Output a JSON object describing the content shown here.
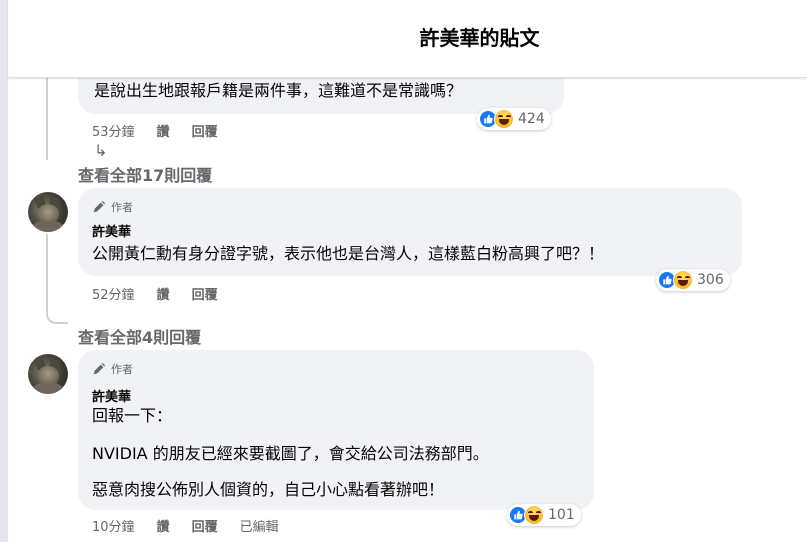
{
  "header": {
    "title": "許美華的貼文"
  },
  "comments": [
    {
      "text": "是說出生地跟報戶籍是兩件事，這難道不是常識嗎？",
      "time": "53分鐘",
      "like_label": "讚",
      "reply_label": "回覆",
      "reaction_count": "424",
      "view_replies": "查看全部17則回覆"
    },
    {
      "author_tag": "作者",
      "author": "許美華",
      "text": "公開黃仁勳有身分證字號，表示他也是台灣人，這樣藍白粉高興了吧？！",
      "time": "52分鐘",
      "like_label": "讚",
      "reply_label": "回覆",
      "reaction_count": "306",
      "view_replies": "查看全部4則回覆"
    },
    {
      "author_tag": "作者",
      "author": "許美華",
      "lines": [
        "回報一下：",
        "NVIDIA 的朋友已經來要截圖了，會交給公司法務部門。",
        "惡意肉搜公佈別人個資的，自己小心點看著辦吧！"
      ],
      "time": "10分鐘",
      "like_label": "讚",
      "reply_label": "回覆",
      "edited_label": "已編輯",
      "reaction_count": "101"
    }
  ],
  "icons": {
    "reply_arrow": "reply-arrow-icon",
    "author_badge": "pencil-icon",
    "like": "like-icon",
    "haha": "haha-icon"
  },
  "colors": {
    "bubble": "#f0f2f5",
    "like_blue": "#1877f2",
    "muted_text": "#65676b"
  }
}
